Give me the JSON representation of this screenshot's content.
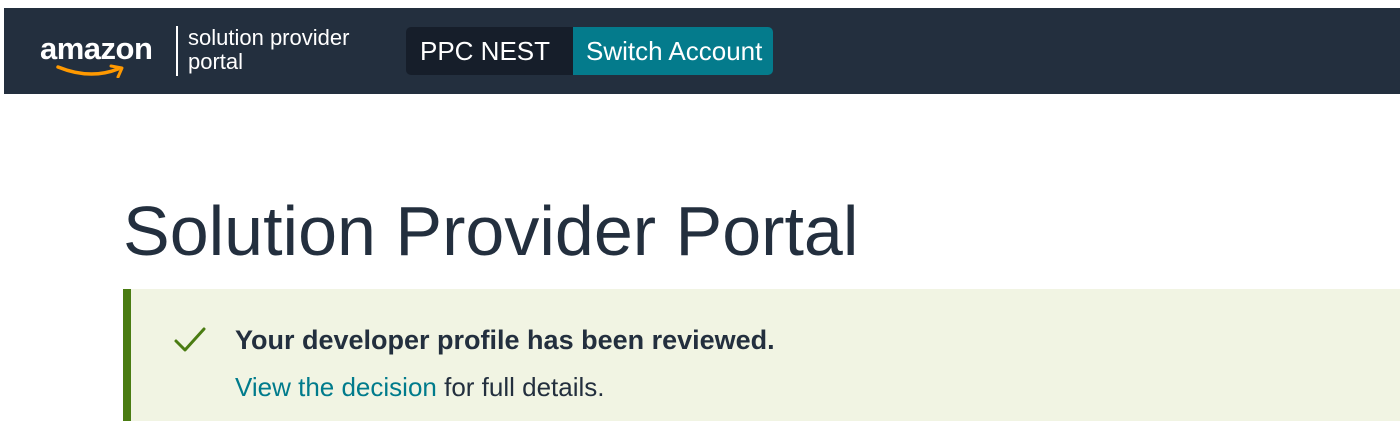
{
  "header": {
    "logo": {
      "brand": "amazon",
      "subtitle_line1": "solution provider",
      "subtitle_line2": "portal"
    },
    "account_name": "PPC NEST",
    "switch_account_label": "Switch Account"
  },
  "main": {
    "title": "Solution Provider Portal",
    "alert": {
      "type": "success",
      "icon": "check-icon",
      "heading": "Your developer profile has been reviewed.",
      "link_text": "View the decision",
      "body_suffix": " for full details."
    }
  },
  "colors": {
    "header_bg": "#232f3e",
    "switch_account_bg": "#047b8c",
    "alert_bg": "#f1f4e3",
    "alert_accent": "#4a7c12",
    "link": "#007b8c",
    "text": "#232f3e",
    "logo_smile": "#ff9900"
  }
}
